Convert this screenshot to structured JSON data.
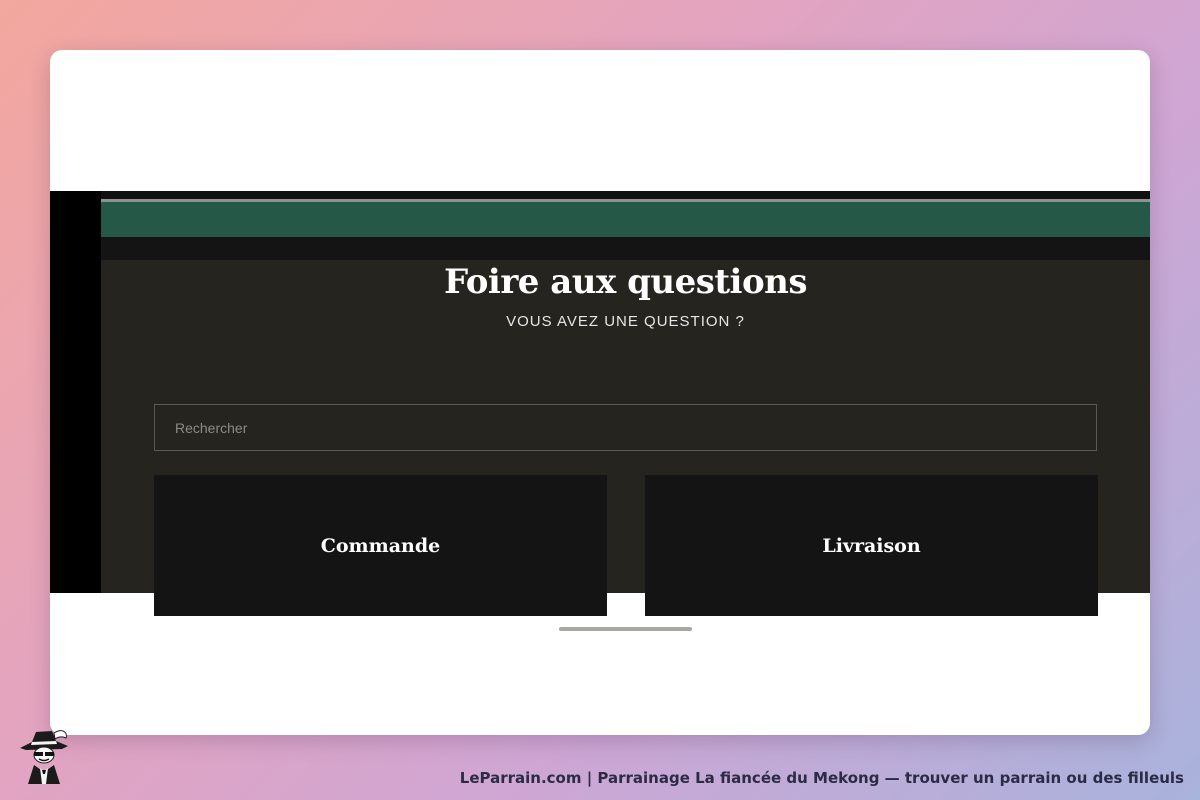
{
  "faq": {
    "title": "Foire aux questions",
    "subtitle": "VOUS AVEZ UNE QUESTION ?",
    "search_placeholder": "Rechercher",
    "categories": [
      {
        "label": "Commande"
      },
      {
        "label": "Livraison"
      }
    ]
  },
  "footer": {
    "caption": "LeParrain.com | Parrainage La fiancée du Mekong — trouver un parrain ou des filleuls",
    "logo_icon": "godfather-mascot-icon"
  },
  "colors": {
    "accent_green": "#265848",
    "panel_dark": "#26241f",
    "card_dark": "#141414"
  }
}
